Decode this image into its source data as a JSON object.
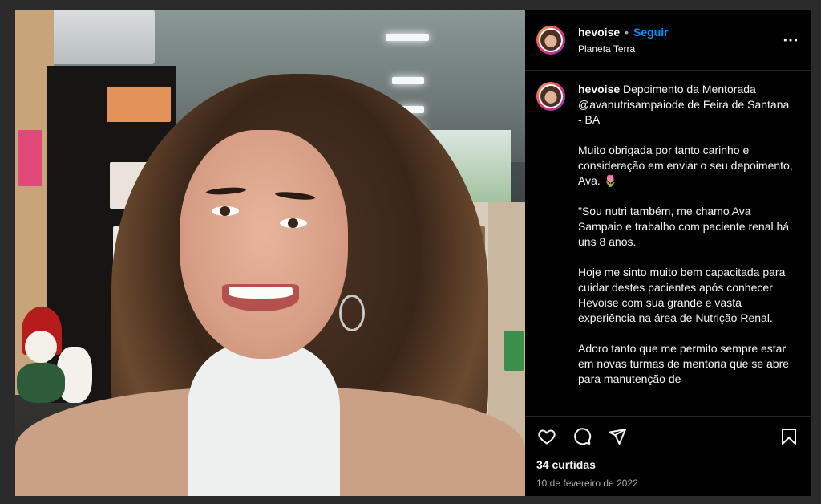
{
  "post": {
    "username": "hevoise",
    "follow_label": "Seguir",
    "separator": "•",
    "location": "Planeta Terra",
    "more_icon": "more-horizontal-icon",
    "caption_user": "hevoise",
    "caption_paragraphs": [
      "Depoimento da Mentorada @avanutrisampaiode de Feira de Santana - BA",
      "Muito obrigada por tanto carinho e consideração em enviar o seu depoimento, Ava. 🌷",
      "\"Sou nutri também, me chamo Ava Sampaio e trabalho com paciente renal há uns 8 anos.",
      "Hoje me sinto muito bem capacitada para cuidar destes pacientes após conhecer Hevoise com sua grande e vasta experiência na área de Nutrição Renal.",
      "Adoro tanto que me permito sempre estar em novas turmas de mentoria que se abre para manutenção de"
    ],
    "likes": "34 curtidas",
    "date": "10 de fevereiro de 2022",
    "icons": [
      "heart-icon",
      "comment-icon",
      "share-icon",
      "bookmark-icon"
    ]
  }
}
